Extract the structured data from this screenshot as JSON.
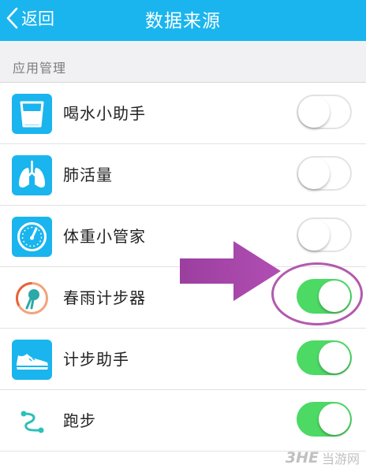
{
  "header": {
    "back_label": "返回",
    "title": "数据来源",
    "color": "#1ab5ee"
  },
  "section": {
    "title": "应用管理"
  },
  "apps": [
    {
      "label": "喝水小助手",
      "icon": "water-cup-icon",
      "enabled": false
    },
    {
      "label": "肺活量",
      "icon": "lungs-icon",
      "enabled": false
    },
    {
      "label": "体重小管家",
      "icon": "weight-scale-icon",
      "enabled": false
    },
    {
      "label": "春雨计步器",
      "icon": "chunyu-pedometer-icon",
      "enabled": true
    },
    {
      "label": "计步助手",
      "icon": "sneaker-icon",
      "enabled": true
    },
    {
      "label": "跑步",
      "icon": "running-route-icon",
      "enabled": true
    }
  ],
  "colors": {
    "toggle_on": "#4cd964",
    "annotation": "#a24aa4"
  },
  "watermark": {
    "brand": "3HE",
    "text": "当游网"
  }
}
